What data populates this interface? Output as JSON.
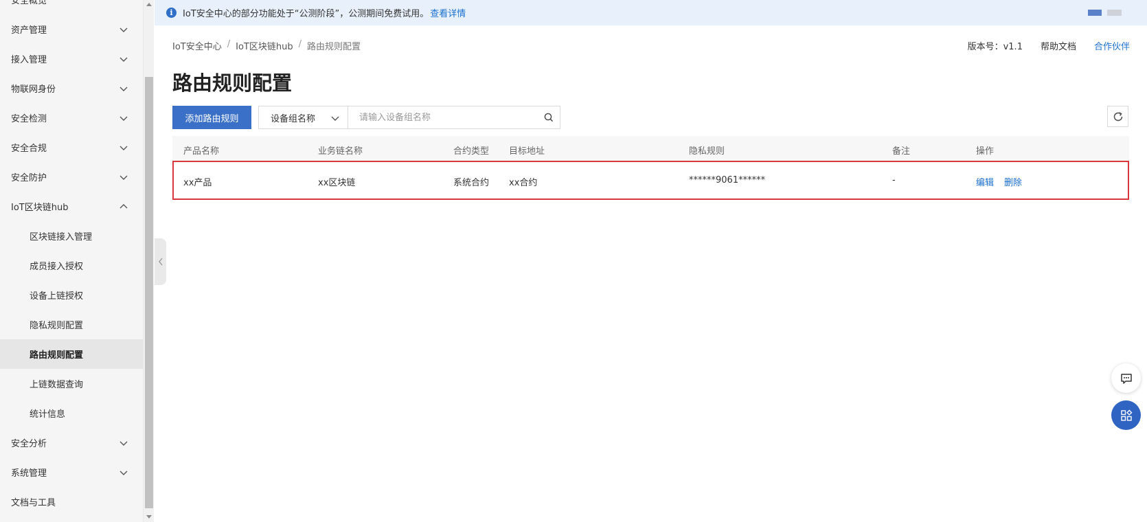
{
  "sidebar": {
    "items": [
      {
        "label": "安全概览",
        "type": "top"
      },
      {
        "label": "资产管理",
        "type": "group",
        "expanded": false
      },
      {
        "label": "接入管理",
        "type": "group",
        "expanded": false
      },
      {
        "label": "物联网身份",
        "type": "group",
        "expanded": false
      },
      {
        "label": "安全检测",
        "type": "group",
        "expanded": false
      },
      {
        "label": "安全合规",
        "type": "group",
        "expanded": false
      },
      {
        "label": "安全防护",
        "type": "group",
        "expanded": false
      },
      {
        "label": "IoT区块链hub",
        "type": "group",
        "expanded": true
      },
      {
        "label": "区块链接入管理",
        "type": "sub"
      },
      {
        "label": "成员接入授权",
        "type": "sub"
      },
      {
        "label": "设备上链授权",
        "type": "sub"
      },
      {
        "label": "隐私规则配置",
        "type": "sub"
      },
      {
        "label": "路由规则配置",
        "type": "sub",
        "active": true
      },
      {
        "label": "上链数据查询",
        "type": "sub"
      },
      {
        "label": "统计信息",
        "type": "sub"
      },
      {
        "label": "安全分析",
        "type": "group",
        "expanded": false
      },
      {
        "label": "系统管理",
        "type": "group",
        "expanded": false
      },
      {
        "label": "文档与工具",
        "type": "top"
      }
    ]
  },
  "notice": {
    "text": "IoT安全中心的部分功能处于“公测阶段”，公测期间免费试用。",
    "link": "查看详情"
  },
  "breadcrumb": {
    "items": [
      "IoT安全中心",
      "IoT区块链hub",
      "路由规则配置"
    ]
  },
  "header": {
    "version": "版本号：v1.1",
    "help": "帮助文档",
    "partner": "合作伙伴"
  },
  "page_title": "路由规则配置",
  "toolbar": {
    "add_label": "添加路由规则",
    "select_value": "设备组名称",
    "search_placeholder": "请输入设备组名称"
  },
  "table": {
    "columns": [
      "产品名称",
      "业务链名称",
      "合约类型",
      "目标地址",
      "隐私规则",
      "备注",
      "操作"
    ],
    "rows": [
      {
        "product": "xx产品",
        "chain": "xx区块链",
        "contract_type": "系统合约",
        "target": "xx合约",
        "privacy_rule": "******9061******",
        "note": "-",
        "edit": "编辑",
        "delete": "删除"
      }
    ]
  },
  "colors": {
    "primary": "#3a70c7",
    "link": "#1a6fd0",
    "highlight_border": "#d9363e",
    "notice_bg": "#e8f1fb"
  }
}
